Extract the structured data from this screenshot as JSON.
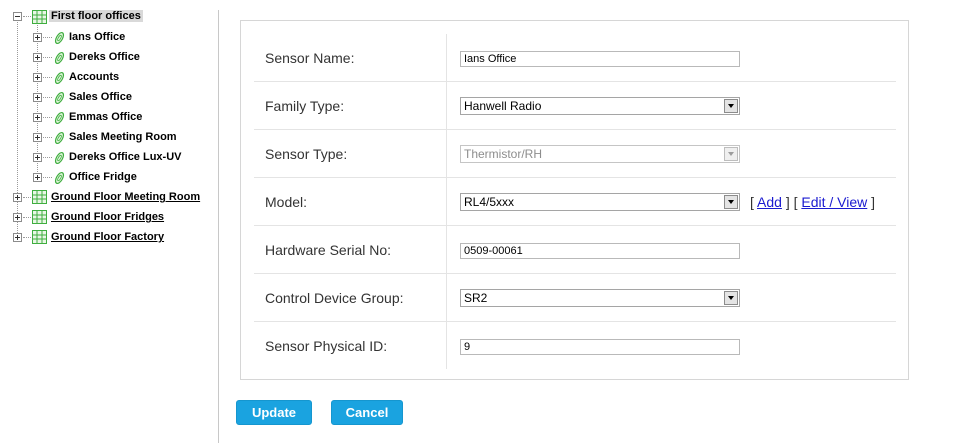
{
  "tree": {
    "root": {
      "label": "First floor offices",
      "icon": "grid-icon",
      "expanded": true
    },
    "children": [
      {
        "label": "Ians Office"
      },
      {
        "label": "Dereks Office"
      },
      {
        "label": "Accounts"
      },
      {
        "label": "Sales Office"
      },
      {
        "label": "Emmas Office"
      },
      {
        "label": "Sales Meeting Room"
      },
      {
        "label": "Dereks Office Lux-UV"
      },
      {
        "label": "Office Fridge"
      }
    ],
    "siblings": [
      {
        "label": "Ground Floor Meeting Room"
      },
      {
        "label": "Ground Floor Fridges"
      },
      {
        "label": "Ground Floor Factory"
      }
    ]
  },
  "form": {
    "sensor_name": {
      "label": "Sensor Name:",
      "value": "Ians Office"
    },
    "family_type": {
      "label": "Family Type:",
      "value": "Hanwell Radio"
    },
    "sensor_type": {
      "label": "Sensor Type:",
      "value": "Thermistor/RH"
    },
    "model": {
      "label": "Model:",
      "value": "RL4/5xxx",
      "bracket_open": "[",
      "add_link": "Add",
      "bracket_mid": "] [",
      "edit_link": "Edit / View",
      "bracket_close": "]"
    },
    "hardware_serial": {
      "label": "Hardware Serial No:",
      "value": "0509-00061"
    },
    "control_group": {
      "label": "Control Device Group:",
      "value": "SR2"
    },
    "physical_id": {
      "label": "Sensor Physical ID:",
      "value": "9"
    }
  },
  "buttons": {
    "update": "Update",
    "cancel": "Cancel"
  },
  "colors": {
    "button": "#1aa3e0",
    "link": "#1a1ad0",
    "tree_icon_green": "#3fae3f"
  }
}
